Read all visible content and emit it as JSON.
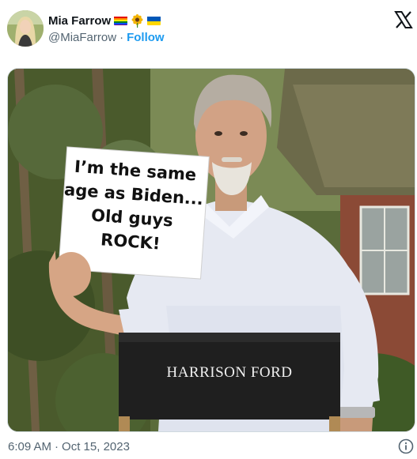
{
  "author": {
    "name": "Mia Farrow",
    "handle": "@MiaFarrow",
    "separator": "·",
    "follow_label": "Follow",
    "badges": [
      "rainbow-flag-icon",
      "sunflower-icon",
      "ukraine-flag-icon"
    ]
  },
  "image": {
    "sign_lines": [
      "I’m the same",
      "age as Biden...",
      "Old guys",
      "ROCK!"
    ],
    "chair_label": "HARRISON FORD"
  },
  "meta": {
    "time": "6:09 AM",
    "separator": "·",
    "date": "Oct 15, 2023"
  },
  "colors": {
    "follow": "#1d9bf0",
    "muted": "#536471",
    "text": "#0f1419"
  }
}
